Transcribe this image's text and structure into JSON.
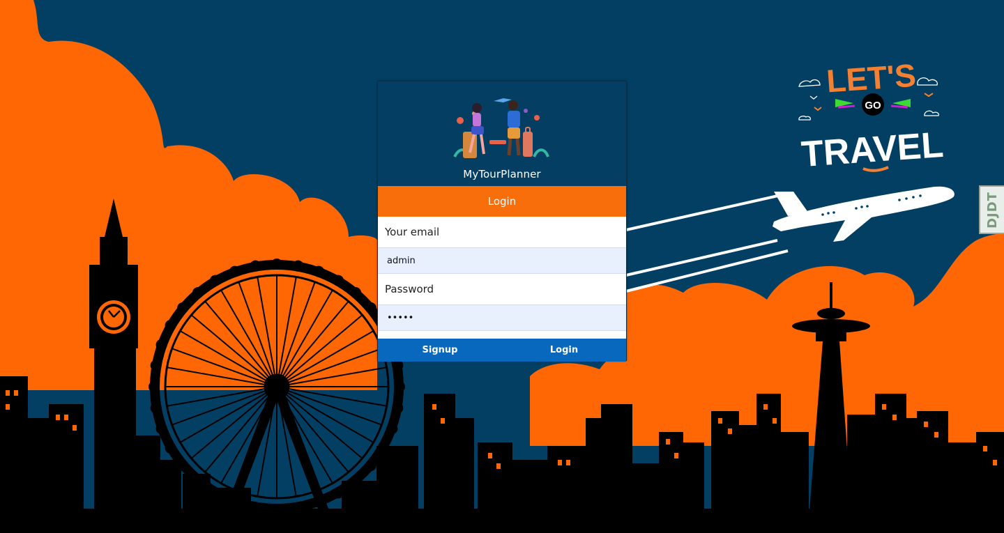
{
  "app": {
    "name": "MyTourPlanner"
  },
  "login_card": {
    "title": "Login",
    "email_label": "Your email",
    "email_value": "admin",
    "password_label": "Password",
    "password_value": "admin",
    "signup_label": "Signup",
    "login_label": "Login"
  },
  "badge": {
    "lets": "LET'S",
    "go": "GO",
    "travel": "TRAVEL"
  },
  "debug_toolbar": {
    "label": "DJDT"
  },
  "colors": {
    "sky": "#033f63",
    "clouds": "#fe6703",
    "silhouette": "#000000",
    "header_orange": "#f86e0b",
    "button_blue": "#0868bd"
  },
  "icons": [
    "travelers-illustration",
    "airplane-icon",
    "ferris-wheel-icon",
    "clock-tower-icon",
    "space-needle-icon"
  ]
}
